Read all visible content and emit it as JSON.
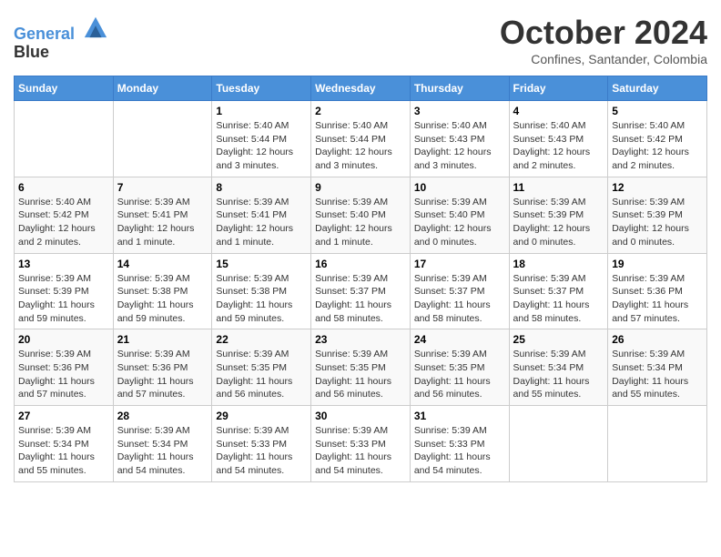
{
  "header": {
    "logo_line1": "General",
    "logo_line2": "Blue",
    "month": "October 2024",
    "location": "Confines, Santander, Colombia"
  },
  "days_of_week": [
    "Sunday",
    "Monday",
    "Tuesday",
    "Wednesday",
    "Thursday",
    "Friday",
    "Saturday"
  ],
  "weeks": [
    [
      {
        "day": "",
        "info": ""
      },
      {
        "day": "",
        "info": ""
      },
      {
        "day": "1",
        "info": "Sunrise: 5:40 AM\nSunset: 5:44 PM\nDaylight: 12 hours\nand 3 minutes."
      },
      {
        "day": "2",
        "info": "Sunrise: 5:40 AM\nSunset: 5:44 PM\nDaylight: 12 hours\nand 3 minutes."
      },
      {
        "day": "3",
        "info": "Sunrise: 5:40 AM\nSunset: 5:43 PM\nDaylight: 12 hours\nand 3 minutes."
      },
      {
        "day": "4",
        "info": "Sunrise: 5:40 AM\nSunset: 5:43 PM\nDaylight: 12 hours\nand 2 minutes."
      },
      {
        "day": "5",
        "info": "Sunrise: 5:40 AM\nSunset: 5:42 PM\nDaylight: 12 hours\nand 2 minutes."
      }
    ],
    [
      {
        "day": "6",
        "info": "Sunrise: 5:40 AM\nSunset: 5:42 PM\nDaylight: 12 hours\nand 2 minutes."
      },
      {
        "day": "7",
        "info": "Sunrise: 5:39 AM\nSunset: 5:41 PM\nDaylight: 12 hours\nand 1 minute."
      },
      {
        "day": "8",
        "info": "Sunrise: 5:39 AM\nSunset: 5:41 PM\nDaylight: 12 hours\nand 1 minute."
      },
      {
        "day": "9",
        "info": "Sunrise: 5:39 AM\nSunset: 5:40 PM\nDaylight: 12 hours\nand 1 minute."
      },
      {
        "day": "10",
        "info": "Sunrise: 5:39 AM\nSunset: 5:40 PM\nDaylight: 12 hours\nand 0 minutes."
      },
      {
        "day": "11",
        "info": "Sunrise: 5:39 AM\nSunset: 5:39 PM\nDaylight: 12 hours\nand 0 minutes."
      },
      {
        "day": "12",
        "info": "Sunrise: 5:39 AM\nSunset: 5:39 PM\nDaylight: 12 hours\nand 0 minutes."
      }
    ],
    [
      {
        "day": "13",
        "info": "Sunrise: 5:39 AM\nSunset: 5:39 PM\nDaylight: 11 hours\nand 59 minutes."
      },
      {
        "day": "14",
        "info": "Sunrise: 5:39 AM\nSunset: 5:38 PM\nDaylight: 11 hours\nand 59 minutes."
      },
      {
        "day": "15",
        "info": "Sunrise: 5:39 AM\nSunset: 5:38 PM\nDaylight: 11 hours\nand 59 minutes."
      },
      {
        "day": "16",
        "info": "Sunrise: 5:39 AM\nSunset: 5:37 PM\nDaylight: 11 hours\nand 58 minutes."
      },
      {
        "day": "17",
        "info": "Sunrise: 5:39 AM\nSunset: 5:37 PM\nDaylight: 11 hours\nand 58 minutes."
      },
      {
        "day": "18",
        "info": "Sunrise: 5:39 AM\nSunset: 5:37 PM\nDaylight: 11 hours\nand 58 minutes."
      },
      {
        "day": "19",
        "info": "Sunrise: 5:39 AM\nSunset: 5:36 PM\nDaylight: 11 hours\nand 57 minutes."
      }
    ],
    [
      {
        "day": "20",
        "info": "Sunrise: 5:39 AM\nSunset: 5:36 PM\nDaylight: 11 hours\nand 57 minutes."
      },
      {
        "day": "21",
        "info": "Sunrise: 5:39 AM\nSunset: 5:36 PM\nDaylight: 11 hours\nand 57 minutes."
      },
      {
        "day": "22",
        "info": "Sunrise: 5:39 AM\nSunset: 5:35 PM\nDaylight: 11 hours\nand 56 minutes."
      },
      {
        "day": "23",
        "info": "Sunrise: 5:39 AM\nSunset: 5:35 PM\nDaylight: 11 hours\nand 56 minutes."
      },
      {
        "day": "24",
        "info": "Sunrise: 5:39 AM\nSunset: 5:35 PM\nDaylight: 11 hours\nand 56 minutes."
      },
      {
        "day": "25",
        "info": "Sunrise: 5:39 AM\nSunset: 5:34 PM\nDaylight: 11 hours\nand 55 minutes."
      },
      {
        "day": "26",
        "info": "Sunrise: 5:39 AM\nSunset: 5:34 PM\nDaylight: 11 hours\nand 55 minutes."
      }
    ],
    [
      {
        "day": "27",
        "info": "Sunrise: 5:39 AM\nSunset: 5:34 PM\nDaylight: 11 hours\nand 55 minutes."
      },
      {
        "day": "28",
        "info": "Sunrise: 5:39 AM\nSunset: 5:34 PM\nDaylight: 11 hours\nand 54 minutes."
      },
      {
        "day": "29",
        "info": "Sunrise: 5:39 AM\nSunset: 5:33 PM\nDaylight: 11 hours\nand 54 minutes."
      },
      {
        "day": "30",
        "info": "Sunrise: 5:39 AM\nSunset: 5:33 PM\nDaylight: 11 hours\nand 54 minutes."
      },
      {
        "day": "31",
        "info": "Sunrise: 5:39 AM\nSunset: 5:33 PM\nDaylight: 11 hours\nand 54 minutes."
      },
      {
        "day": "",
        "info": ""
      },
      {
        "day": "",
        "info": ""
      }
    ]
  ]
}
